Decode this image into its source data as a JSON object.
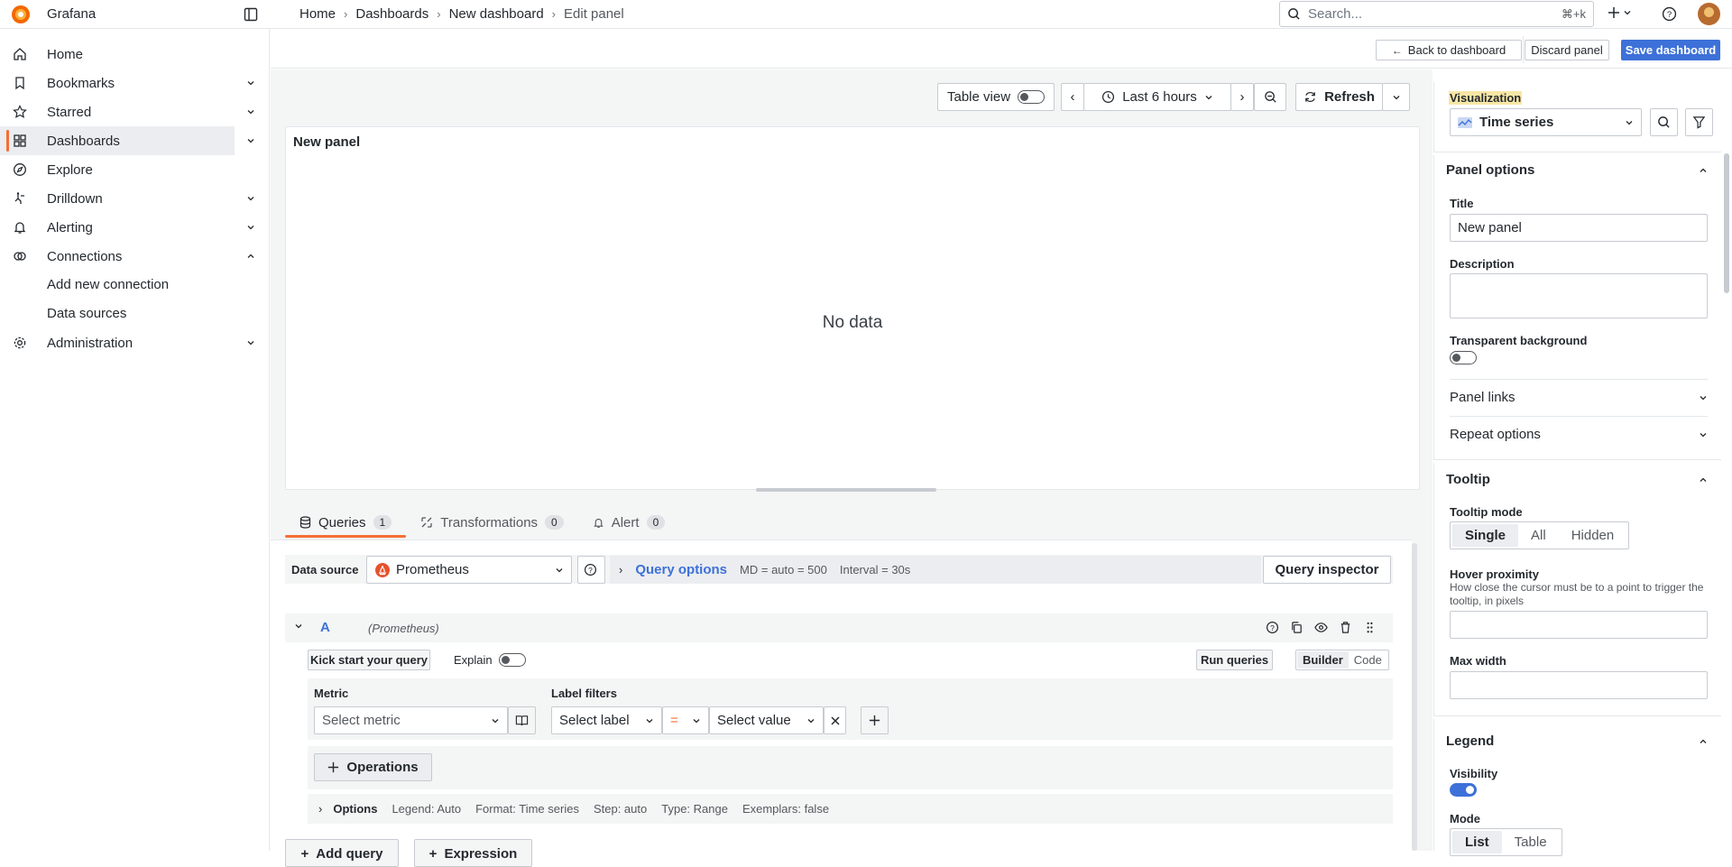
{
  "app": {
    "name": "Grafana"
  },
  "breadcrumbs": [
    "Home",
    "Dashboards",
    "New dashboard",
    "Edit panel"
  ],
  "search": {
    "placeholder": "Search...",
    "shortcut": "⌘+k"
  },
  "sidebar": {
    "items": [
      {
        "label": "Home",
        "icon": "home-icon"
      },
      {
        "label": "Bookmarks",
        "icon": "bookmark-icon",
        "expandable": true
      },
      {
        "label": "Starred",
        "icon": "star-icon",
        "expandable": true
      },
      {
        "label": "Dashboards",
        "icon": "apps-icon",
        "expandable": true,
        "active": true
      },
      {
        "label": "Explore",
        "icon": "compass-icon"
      },
      {
        "label": "Drilldown",
        "icon": "drilldown-icon",
        "expandable": true
      },
      {
        "label": "Alerting",
        "icon": "bell-icon",
        "expandable": true
      },
      {
        "label": "Connections",
        "icon": "connections-icon",
        "expanded": true
      },
      {
        "label": "Administration",
        "icon": "cog-icon",
        "expandable": true
      }
    ],
    "sub_items": [
      "Add new connection",
      "Data sources"
    ]
  },
  "actions": {
    "back": "Back to dashboard",
    "discard": "Discard panel",
    "save": "Save dashboard"
  },
  "panel_toolbar": {
    "table_view": "Table view",
    "time_range": "Last 6 hours",
    "refresh": "Refresh"
  },
  "panel": {
    "title": "New panel",
    "empty_message": "No data"
  },
  "editor_tabs": [
    {
      "label": "Queries",
      "count": "1"
    },
    {
      "label": "Transformations",
      "count": "0"
    },
    {
      "label": "Alert",
      "count": "0"
    }
  ],
  "query": {
    "datasource_label": "Data source",
    "datasource": "Prometheus",
    "query_options": "Query options",
    "md": "MD = auto = 500",
    "interval": "Interval = 30s",
    "inspector": "Query inspector",
    "ref_id": "A",
    "ds_tag": "(Prometheus)",
    "kick_start": "Kick start your query",
    "explain": "Explain",
    "run": "Run queries",
    "builder": "Builder",
    "code": "Code",
    "metric_label": "Metric",
    "metric_placeholder": "Select metric",
    "label_filters": "Label filters",
    "select_label": "Select label",
    "operator": "=",
    "select_value": "Select value",
    "operations": "Operations",
    "options_label": "Options",
    "options_summary": [
      "Legend: Auto",
      "Format: Time series",
      "Step: auto",
      "Type: Range",
      "Exemplars: false"
    ],
    "add_query": "Add query",
    "expression": "Expression"
  },
  "options_pane": {
    "viz_label": "Visualization",
    "viz": "Time series",
    "panel_options": "Panel options",
    "title_label": "Title",
    "title_value": "New panel",
    "description_label": "Description",
    "transparent_label": "Transparent background",
    "panel_links": "Panel links",
    "repeat_options": "Repeat options",
    "tooltip": "Tooltip",
    "tooltip_mode": "Tooltip mode",
    "tooltip_modes": [
      "Single",
      "All",
      "Hidden"
    ],
    "hover_proximity": "Hover proximity",
    "hover_desc": "How close the cursor must be to a point to trigger the tooltip, in pixels",
    "max_width": "Max width",
    "legend": "Legend",
    "visibility": "Visibility",
    "mode": "Mode",
    "modes": [
      "List",
      "Table"
    ]
  },
  "colors": {
    "accent": "#3d71d9",
    "brand": "#f56f35",
    "highlight": "#f7e7a6"
  }
}
